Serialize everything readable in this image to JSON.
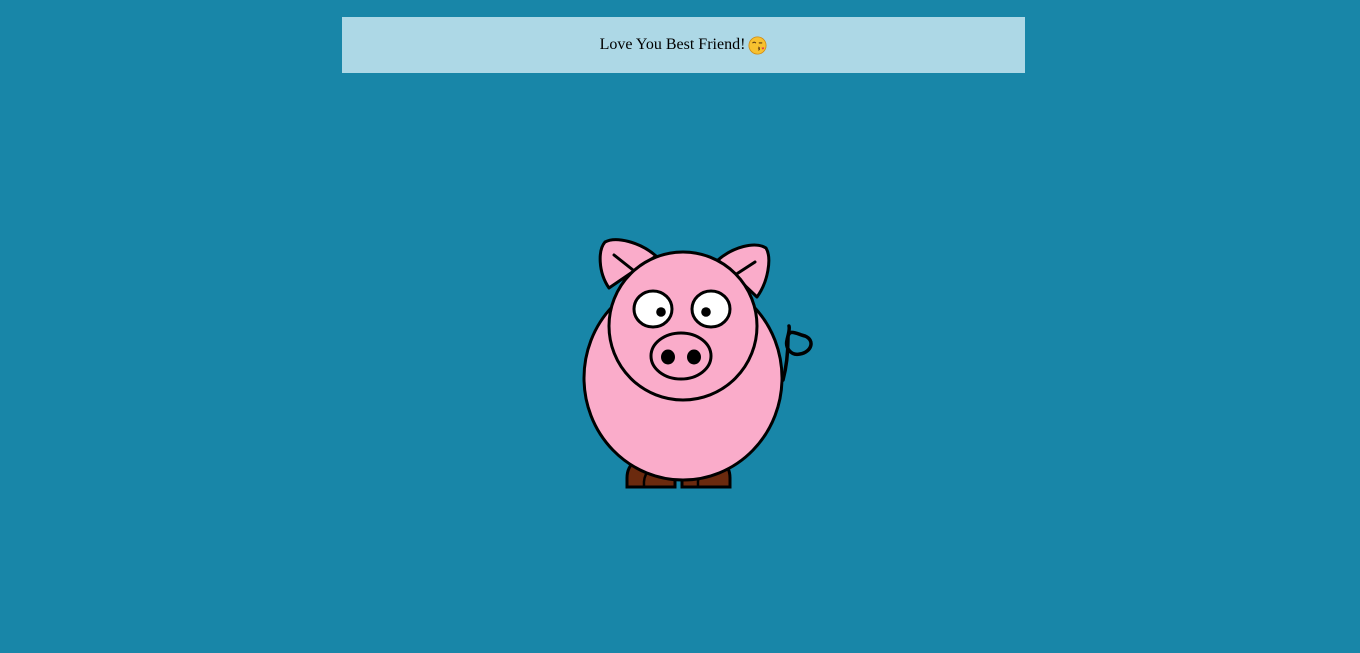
{
  "banner": {
    "message": "Love You Best Friend!",
    "emoji": "face-blowing-kiss-icon"
  },
  "colors": {
    "background": "#1886a8",
    "banner_background": "#add8e6",
    "pig_body": "#faacca",
    "pig_outline": "#000000",
    "hooves": "#6b2a0e",
    "eye_white": "#ffffff"
  },
  "illustration": {
    "subject": "pig-icon"
  }
}
